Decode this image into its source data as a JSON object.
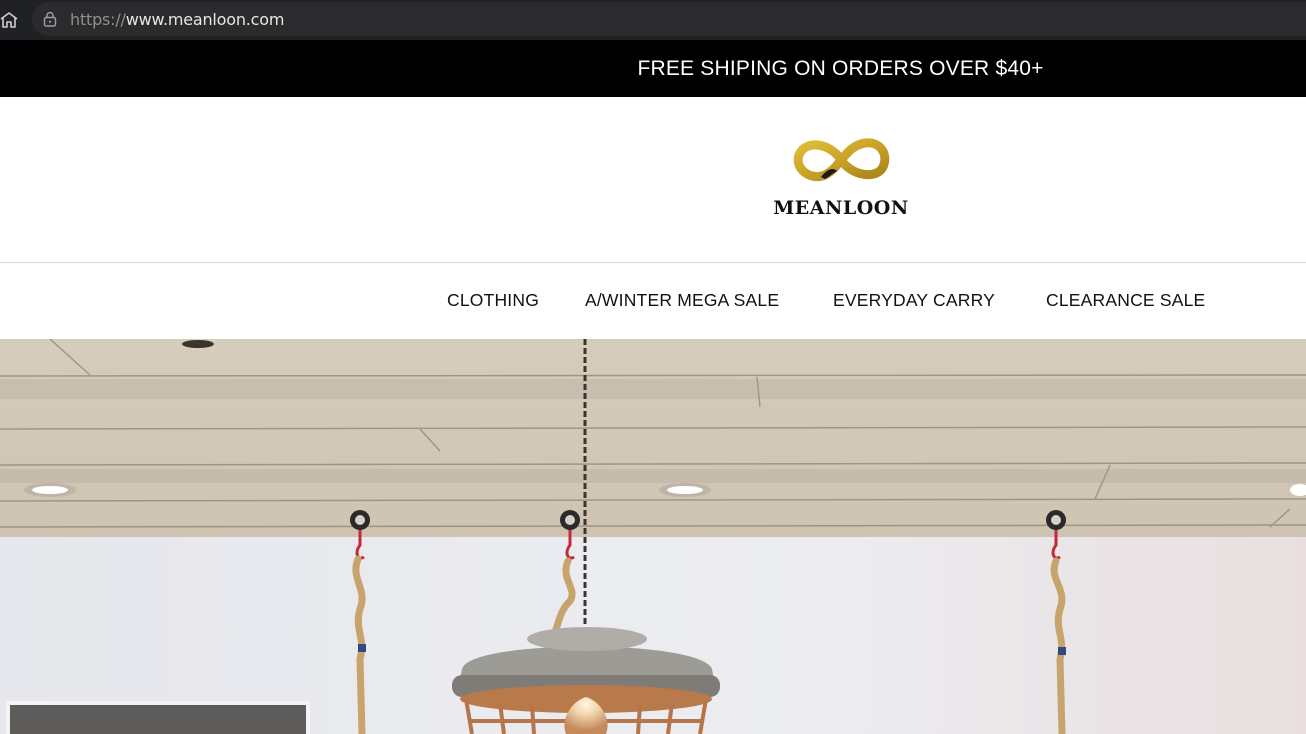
{
  "browser": {
    "url_scheme": "https://",
    "url_host": "www.meanloon.com",
    "icons": [
      "home-icon",
      "lock-icon"
    ]
  },
  "announcement": {
    "text": "FREE SHIPING ON ORDERS OVER $40+"
  },
  "header": {
    "logo_text": "MEANLOON",
    "logo_color": "#c9a227"
  },
  "nav": {
    "items": [
      {
        "label": "CLOTHING"
      },
      {
        "label": "A/WINTER MEGA SALE"
      },
      {
        "label": "EVERYDAY CARRY"
      },
      {
        "label": "CLEARANCE SALE"
      }
    ]
  },
  "hero": {
    "description": "pendant-lamp-photo"
  }
}
